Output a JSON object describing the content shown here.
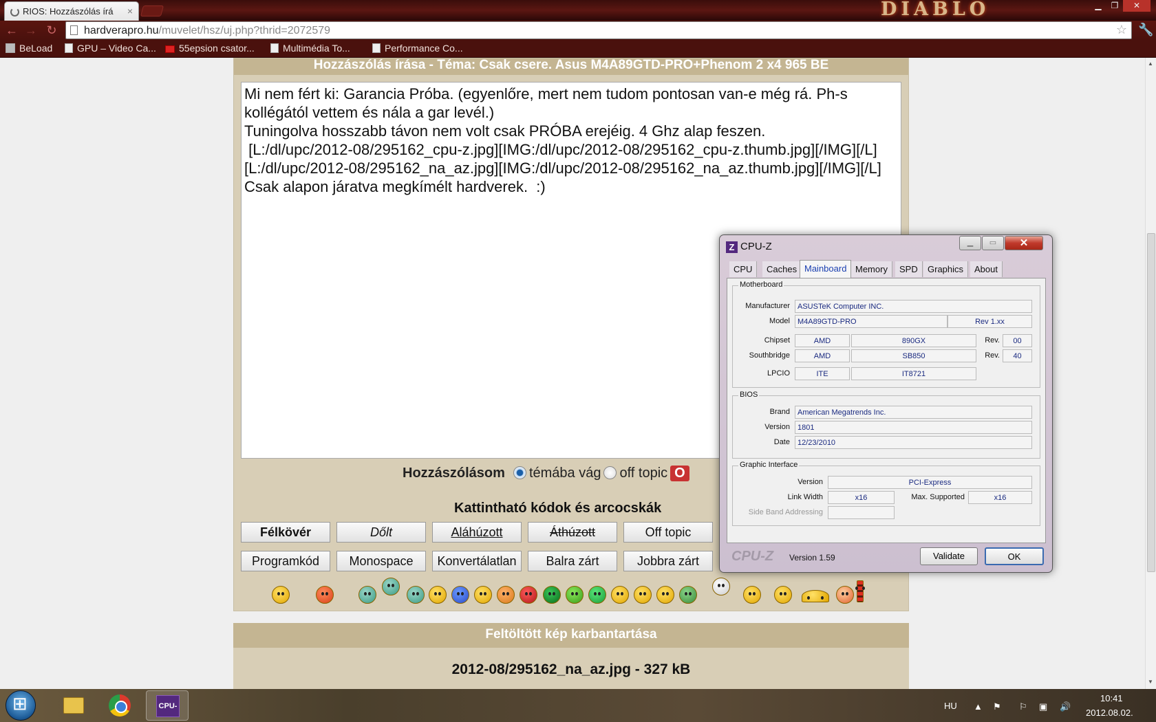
{
  "browser": {
    "tab_title": "RIOS: Hozzászólás írá",
    "tab_close": "×",
    "brand_logo": "DIABLO",
    "url_host": "hardverapro.hu",
    "url_path": "/muvelet/hsz/uj.php?thrid=2072579",
    "bookmarks": [
      "BeLoad",
      "GPU – Video Ca...",
      "55epsion csator...",
      "Multimédia To...",
      "Performance Co..."
    ]
  },
  "page": {
    "header": "Hozzászólás írása - Téma: Csak csere. Asus M4A89GTD-PRO+Phenom 2 x4 965 BE",
    "textarea_text": "Mi nem fért ki: Garancia Próba. (egyenlőre, mert nem tudom pontosan van-e még rá. Ph-s kollégától vettem és nála a gar levél.)\nTuningolva hosszabb távon nem volt csak PRÓBA erejéig. 4 Ghz alap feszen.\n [L:/dl/upc/2012-08/295162_cpu-z.jpg][IMG:/dl/upc/2012-08/295162_cpu-z.thumb.jpg][/IMG][/L]\n[L:/dl/upc/2012-08/295162_na_az.jpg][IMG:/dl/upc/2012-08/295162_na_az.thumb.jpg][/IMG][/L]\nCsak alapon járatva megkímélt hardverek.  :)",
    "post_type_label": "Hozzászólásom",
    "option_topic": "témába vág",
    "option_offtopic": "off topic",
    "option_other": "O",
    "codes_title": "Kattintható kódok és arcocskák",
    "buttons_row1": [
      "Félkövér",
      "Dőlt",
      "Aláhúzott",
      "Áthúzott",
      "Off topic"
    ],
    "buttons_row2": [
      "Programkód",
      "Monospace",
      "Konvertálatlan",
      "Balra zárt",
      "Jobbra zárt"
    ],
    "upload_header": "Feltöltött kép karbantartása",
    "file_info": "2012-08/295162_na_az.jpg - 327 kB"
  },
  "cpuz": {
    "title": "CPU-Z",
    "tabs": [
      "CPU",
      "Caches",
      "Mainboard",
      "Memory",
      "SPD",
      "Graphics",
      "About"
    ],
    "active_tab": "Mainboard",
    "motherboard": {
      "group": "Motherboard",
      "manufacturer_label": "Manufacturer",
      "manufacturer": "ASUSTeK Computer INC.",
      "model_label": "Model",
      "model": "M4A89GTD-PRO",
      "model_rev": "Rev 1.xx",
      "chipset_label": "Chipset",
      "chipset_vendor": "AMD",
      "chipset_model": "890GX",
      "rev_label": "Rev.",
      "chipset_rev": "00",
      "southbridge_label": "Southbridge",
      "sb_vendor": "AMD",
      "sb_model": "SB850",
      "sb_rev": "40",
      "lpcio_label": "LPCIO",
      "lpcio_vendor": "ITE",
      "lpcio_model": "IT8721"
    },
    "bios": {
      "group": "BIOS",
      "brand_label": "Brand",
      "brand": "American Megatrends Inc.",
      "version_label": "Version",
      "version": "1801",
      "date_label": "Date",
      "date": "12/23/2010"
    },
    "graphic": {
      "group": "Graphic Interface",
      "version_label": "Version",
      "version": "PCI-Express",
      "link_width_label": "Link Width",
      "link_width": "x16",
      "max_supported_label": "Max. Supported",
      "max_supported": "x16",
      "sideband_label": "Side Band Addressing",
      "sideband": ""
    },
    "footer_logo": "CPU-Z",
    "version_text": "Version 1.59",
    "validate_label": "Validate",
    "ok_label": "OK"
  },
  "taskbar": {
    "lang": "HU",
    "time": "10:41",
    "date": "2012.08.02.",
    "cpuz_icon": "CPU-Z"
  }
}
